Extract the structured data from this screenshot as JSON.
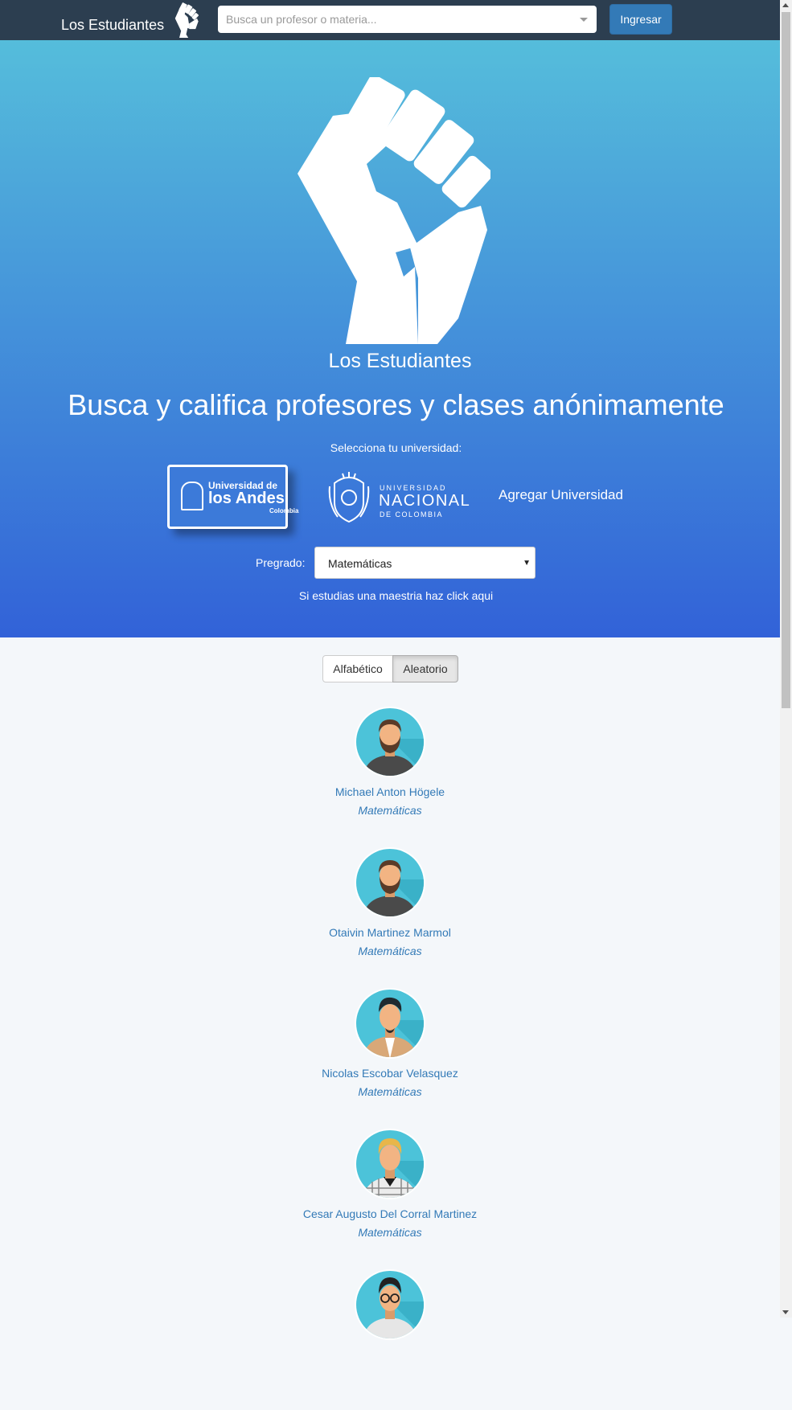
{
  "navbar": {
    "brand": "Los Estudiantes",
    "search_placeholder": "Busca un profesor o materia...",
    "login_label": "Ingresar"
  },
  "hero": {
    "name": "Los Estudiantes",
    "tagline": "Busca y califica profesores y clases anónimamente",
    "select_university_label": "Selecciona tu universidad:",
    "universities": {
      "andes": {
        "line1": "Universidad de",
        "line2": "los Andes",
        "line3": "Colombia"
      },
      "nacional": {
        "line1": "UNIVERSIDAD",
        "line2": "NACIONAL",
        "line3": "DE COLOMBIA"
      }
    },
    "add_university": "Agregar Universidad",
    "pregrado_label": "Pregrado:",
    "pregrado_value": "Matemáticas",
    "maestria_link": "Si estudias una maestria haz click aqui"
  },
  "sort": {
    "alpha_label": "Alfabético",
    "random_label": "Aleatorio",
    "active": "Aleatorio"
  },
  "professors": [
    {
      "name": "Michael Anton Högele",
      "subject": "Matemáticas",
      "avatar": "bearded-man-avatar"
    },
    {
      "name": "Otaivin Martinez Marmol",
      "subject": "Matemáticas",
      "avatar": "bearded-man-avatar"
    },
    {
      "name": "Nicolas Escobar Velasquez",
      "subject": "Matemáticas",
      "avatar": "man-tan-jacket-avatar"
    },
    {
      "name": "Cesar Augusto Del Corral Martinez",
      "subject": "Matemáticas",
      "avatar": "blond-man-plaid-avatar"
    },
    {
      "name": "",
      "subject": "",
      "avatar": "man-glasses-avatar"
    }
  ],
  "colors": {
    "navbar": "#2c3e50",
    "hero_top": "#55bddb",
    "hero_bottom": "#3262d8",
    "link": "#337ab7",
    "primary_button": "#337ab7",
    "page_background": "#f4f7fa",
    "avatar_background": "#4cc3d9"
  },
  "icons": {
    "brand": "raised-fist-icon",
    "hero": "raised-fist-icon",
    "search_caret": "caret-down-icon",
    "select_arrow": "triangle-down-icon"
  }
}
